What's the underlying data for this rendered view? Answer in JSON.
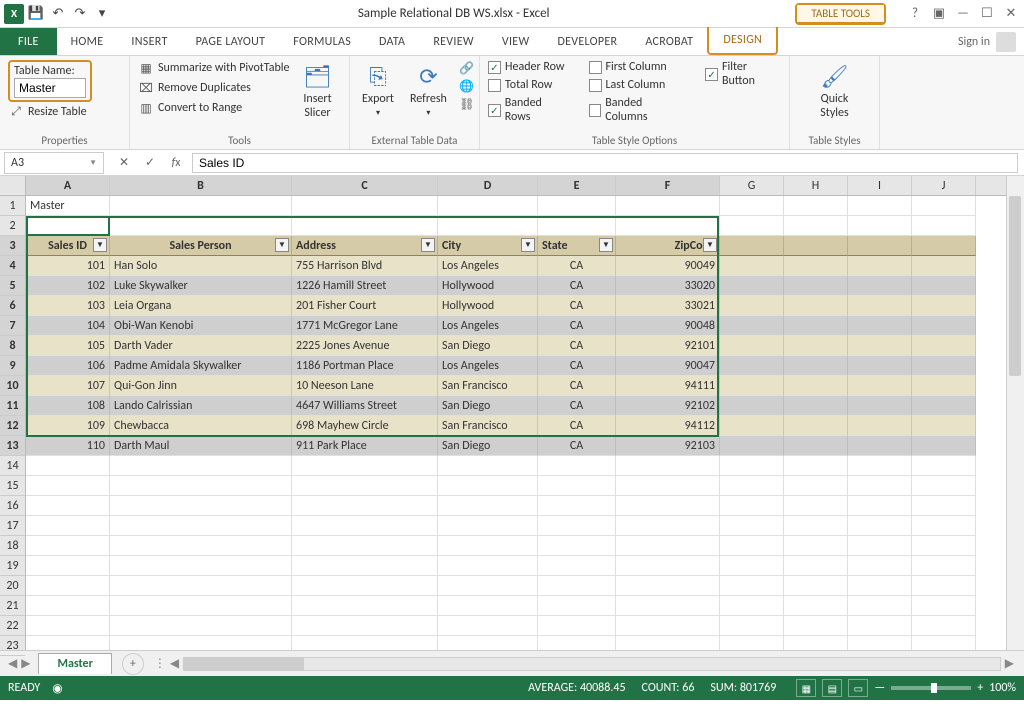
{
  "title": "Sample Relational DB WS.xlsx - Excel",
  "context_tab_group": "TABLE TOOLS",
  "signin": "Sign in",
  "tabs": {
    "file": "FILE",
    "home": "HOME",
    "insert": "INSERT",
    "page_layout": "PAGE LAYOUT",
    "formulas": "FORMULAS",
    "data": "DATA",
    "review": "REVIEW",
    "view": "VIEW",
    "developer": "DEVELOPER",
    "acrobat": "Acrobat",
    "design": "DESIGN"
  },
  "ribbon": {
    "properties": {
      "table_name_label": "Table Name:",
      "table_name_value": "Master",
      "resize": "Resize Table",
      "group": "Properties"
    },
    "tools": {
      "pivot": "Summarize with PivotTable",
      "dup": "Remove Duplicates",
      "range": "Convert to Range",
      "slicer": "Insert\nSlicer",
      "group": "Tools"
    },
    "external": {
      "export": "Export",
      "refresh": "Refresh",
      "group": "External Table Data"
    },
    "styleopts": {
      "header_row": "Header Row",
      "total_row": "Total Row",
      "banded_rows": "Banded Rows",
      "first_col": "First Column",
      "last_col": "Last Column",
      "banded_cols": "Banded Columns",
      "filter_btn": "Filter Button",
      "group": "Table Style Options"
    },
    "styles": {
      "quick": "Quick\nStyles",
      "group": "Table Styles"
    }
  },
  "formula_bar": {
    "namebox": "A3",
    "formula": "Sales ID"
  },
  "columns": [
    "A",
    "B",
    "C",
    "D",
    "E",
    "F",
    "G",
    "H",
    "I",
    "J"
  ],
  "row_numbers": [
    1,
    2,
    3,
    4,
    5,
    6,
    7,
    8,
    9,
    10,
    11,
    12,
    13,
    14,
    15,
    16,
    17,
    18,
    19,
    20,
    21,
    22,
    23
  ],
  "cells": {
    "A1": "Master"
  },
  "table": {
    "headers": [
      "Sales ID",
      "Sales Person",
      "Address",
      "City",
      "State",
      "ZipCode"
    ],
    "rows": [
      [
        "101",
        "Han Solo",
        "755 Harrison Blvd",
        "Los Angeles",
        "CA",
        "90049"
      ],
      [
        "102",
        "Luke Skywalker",
        "1226 Hamill Street",
        "Hollywood",
        "CA",
        "33020"
      ],
      [
        "103",
        "Leia Organa",
        "201 Fisher Court",
        "Hollywood",
        "CA",
        "33021"
      ],
      [
        "104",
        "Obi-Wan Kenobi",
        "1771 McGregor Lane",
        "Los Angeles",
        "CA",
        "90048"
      ],
      [
        "105",
        "Darth Vader",
        "2225 Jones Avenue",
        "San Diego",
        "CA",
        "92101"
      ],
      [
        "106",
        "Padme Amidala Skywalker",
        "1186 Portman Place",
        "Los Angeles",
        "CA",
        "90047"
      ],
      [
        "107",
        "Qui-Gon Jinn",
        "10 Neeson Lane",
        "San Francisco",
        "CA",
        "94111"
      ],
      [
        "108",
        "Lando Calrissian",
        "4647 Williams Street",
        "San Diego",
        "CA",
        "92102"
      ],
      [
        "109",
        "Chewbacca",
        "698 Mayhew Circle",
        "San Francisco",
        "CA",
        "94112"
      ],
      [
        "110",
        "Darth Maul",
        "911 Park Place",
        "San Diego",
        "CA",
        "92103"
      ]
    ]
  },
  "sheet": {
    "active": "Master"
  },
  "status": {
    "ready": "READY",
    "average_label": "AVERAGE:",
    "average": "40088.45",
    "count_label": "COUNT:",
    "count": "66",
    "sum_label": "SUM:",
    "sum": "801769",
    "zoom": "100%"
  }
}
